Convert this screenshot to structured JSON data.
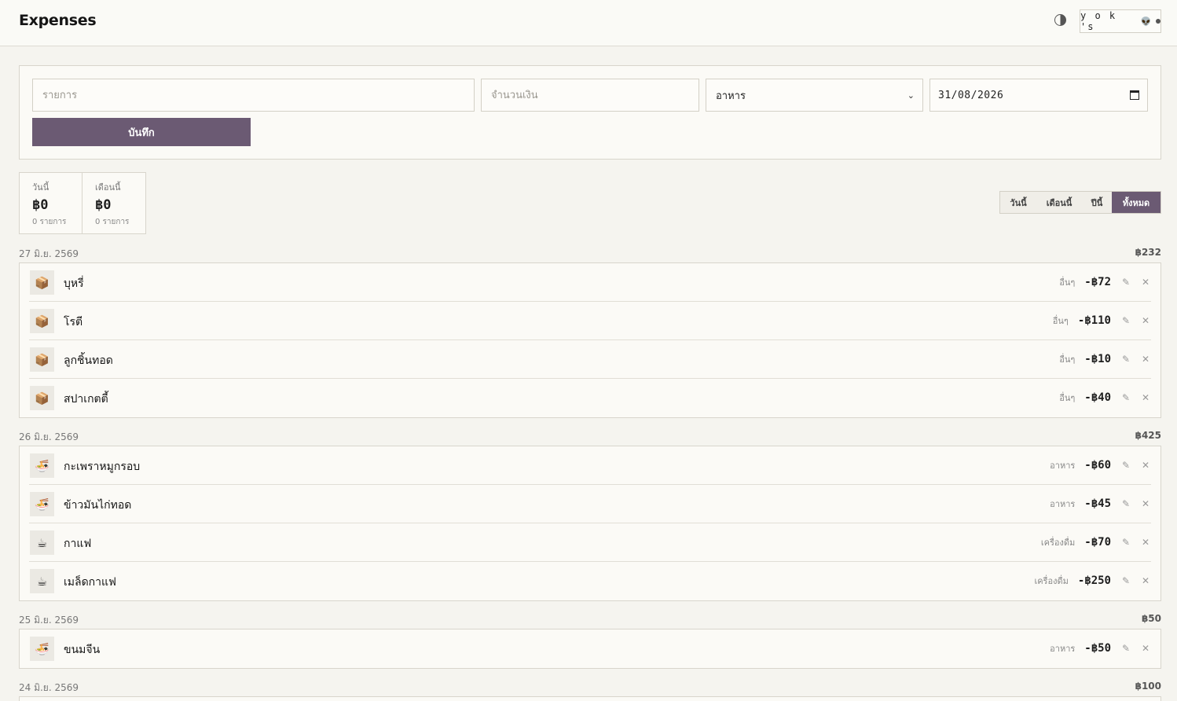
{
  "header": {
    "title": "Expenses",
    "user": "y o k 's",
    "user_emoji": "👽"
  },
  "form": {
    "item_placeholder": "รายการ",
    "amount_placeholder": "จำนวนเงิน",
    "category_value": "อาหาร",
    "date_value": "31/08/2026",
    "save_label": "บันทึก"
  },
  "stats": [
    {
      "label": "วันนี้",
      "value": "฿0",
      "count": "0 รายการ"
    },
    {
      "label": "เดือนนี้",
      "value": "฿0",
      "count": "0 รายการ"
    }
  ],
  "filters": [
    {
      "label": "วันนี้",
      "active": false
    },
    {
      "label": "เดือนนี้",
      "active": false
    },
    {
      "label": "ปีนี้",
      "active": false
    },
    {
      "label": "ทั้งหมด",
      "active": true
    }
  ],
  "days": [
    {
      "date": "27 มิ.ย. 2569",
      "total": "฿232",
      "items": [
        {
          "icon": "📦",
          "icon_name": "package-icon",
          "name": "บุหรี่",
          "category": "อื่นๆ",
          "amount": "-฿72"
        },
        {
          "icon": "📦",
          "icon_name": "package-icon",
          "name": "โรตี",
          "category": "อื่นๆ",
          "amount": "-฿110"
        },
        {
          "icon": "📦",
          "icon_name": "package-icon",
          "name": "ลูกชิ้นทอด",
          "category": "อื่นๆ",
          "amount": "-฿10"
        },
        {
          "icon": "📦",
          "icon_name": "package-icon",
          "name": "สปาเกตตี้",
          "category": "อื่นๆ",
          "amount": "-฿40"
        }
      ]
    },
    {
      "date": "26 มิ.ย. 2569",
      "total": "฿425",
      "items": [
        {
          "icon": "🍜",
          "icon_name": "noodle-bowl-icon",
          "name": "กะเพราหมูกรอบ",
          "category": "อาหาร",
          "amount": "-฿60"
        },
        {
          "icon": "🍜",
          "icon_name": "noodle-bowl-icon",
          "name": "ข้าวมันไก่ทอด",
          "category": "อาหาร",
          "amount": "-฿45"
        },
        {
          "icon": "☕",
          "icon_name": "coffee-icon",
          "name": "กาแฟ",
          "category": "เครื่องดื่ม",
          "amount": "-฿70"
        },
        {
          "icon": "☕",
          "icon_name": "coffee-icon",
          "name": "เมล็ดกาแฟ",
          "category": "เครื่องดื่ม",
          "amount": "-฿250"
        }
      ]
    },
    {
      "date": "25 มิ.ย. 2569",
      "total": "฿50",
      "items": [
        {
          "icon": "🍜",
          "icon_name": "noodle-bowl-icon",
          "name": "ขนมจีน",
          "category": "อาหาร",
          "amount": "-฿50"
        }
      ]
    },
    {
      "date": "24 มิ.ย. 2569",
      "total": "฿100",
      "items": []
    }
  ]
}
